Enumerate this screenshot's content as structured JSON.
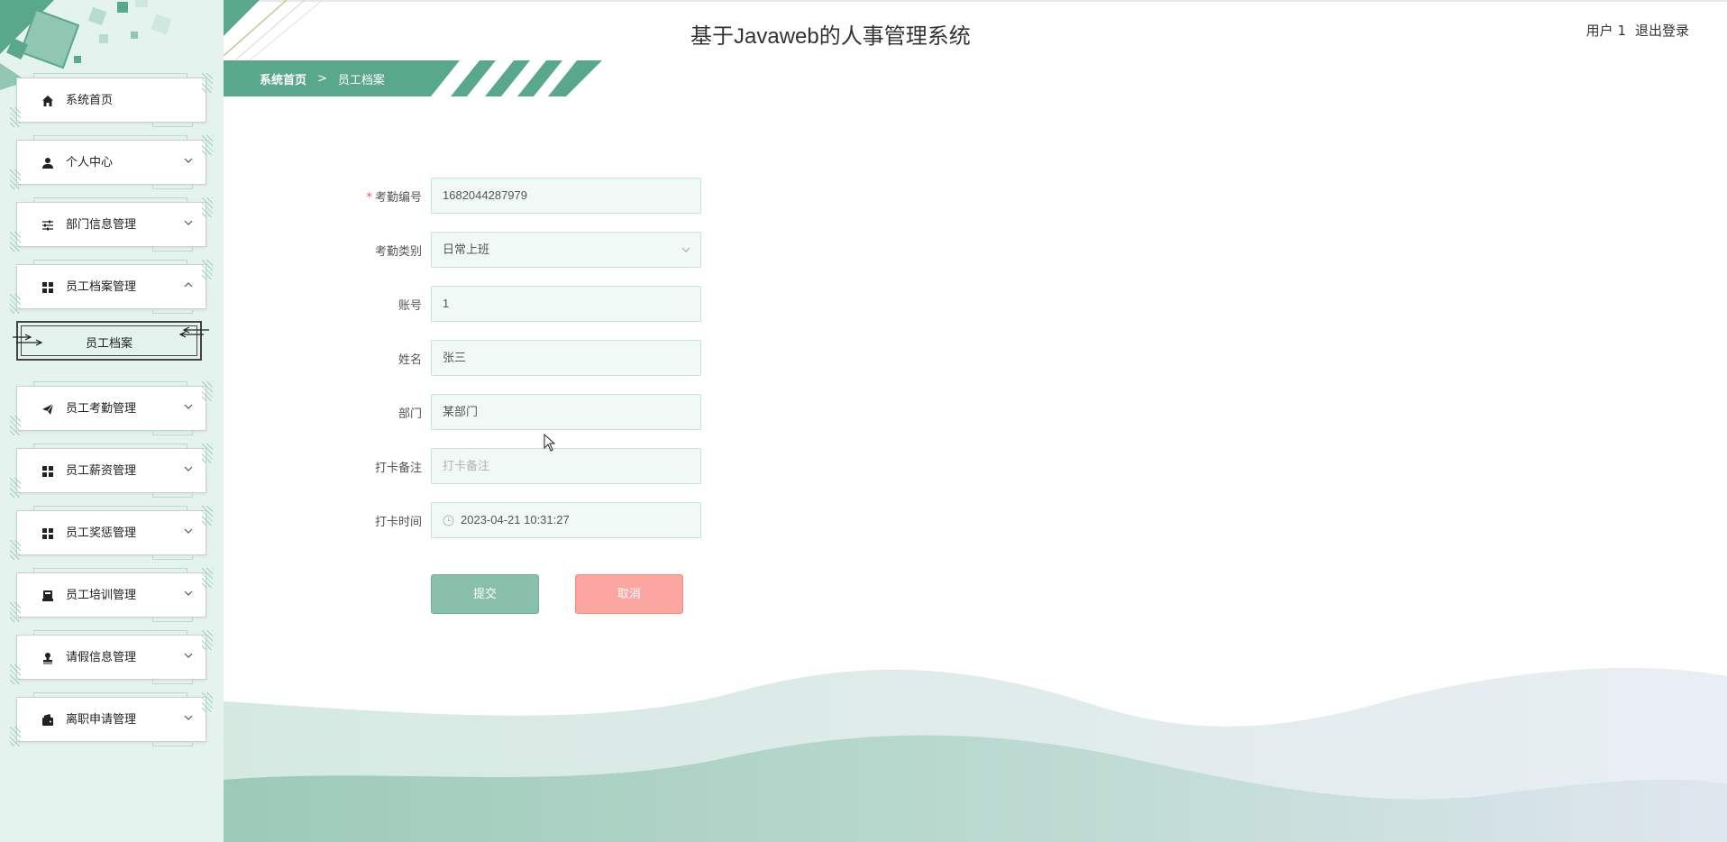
{
  "app": {
    "title": "基于Javaweb的人事管理系统"
  },
  "header": {
    "user": "用户 1",
    "logout": "退出登录"
  },
  "breadcrumb": {
    "home": "系统首页",
    "separator": ">",
    "current": "员工档案"
  },
  "sidebar": {
    "items": [
      {
        "label": "系统首页",
        "icon": "home-icon",
        "expandable": false
      },
      {
        "label": "个人中心",
        "icon": "user-icon",
        "expandable": true
      },
      {
        "label": "部门信息管理",
        "icon": "sliders-icon",
        "expandable": true
      },
      {
        "label": "员工档案管理",
        "icon": "grid-icon",
        "expandable": true,
        "expanded": true
      },
      {
        "label": "员工考勤管理",
        "icon": "paper-plane-icon",
        "expandable": true
      },
      {
        "label": "员工薪资管理",
        "icon": "grid-icon",
        "expandable": true
      },
      {
        "label": "员工奖惩管理",
        "icon": "grid-icon",
        "expandable": true
      },
      {
        "label": "员工培训管理",
        "icon": "training-icon",
        "expandable": true
      },
      {
        "label": "请假信息管理",
        "icon": "stamp-icon",
        "expandable": true
      },
      {
        "label": "离职申请管理",
        "icon": "wallet-icon",
        "expandable": true
      }
    ],
    "subitem": {
      "label": "员工档案"
    }
  },
  "form": {
    "fields": [
      {
        "label": "考勤编号",
        "required": true,
        "value": "1682044287979",
        "type": "text"
      },
      {
        "label": "考勤类别",
        "required": false,
        "value": "日常上班",
        "type": "select"
      },
      {
        "label": "账号",
        "required": false,
        "value": "1",
        "type": "text"
      },
      {
        "label": "姓名",
        "required": false,
        "value": "张三",
        "type": "text"
      },
      {
        "label": "部门",
        "required": false,
        "value": "某部门",
        "type": "text"
      },
      {
        "label": "打卡备注",
        "required": false,
        "value": "",
        "placeholder": "打卡备注",
        "type": "text"
      },
      {
        "label": "打卡时间",
        "required": false,
        "value": "2023-04-21 10:31:27",
        "type": "datetime"
      }
    ],
    "required_mark": "*",
    "submit": "提交",
    "cancel": "取消"
  },
  "colors": {
    "primary": "#5aa88c",
    "sidebar_bg": "#e4f3ee",
    "input_bg": "#f1f9f6",
    "submit_bg": "#88c0ab",
    "cancel_bg": "#fba6a1"
  }
}
